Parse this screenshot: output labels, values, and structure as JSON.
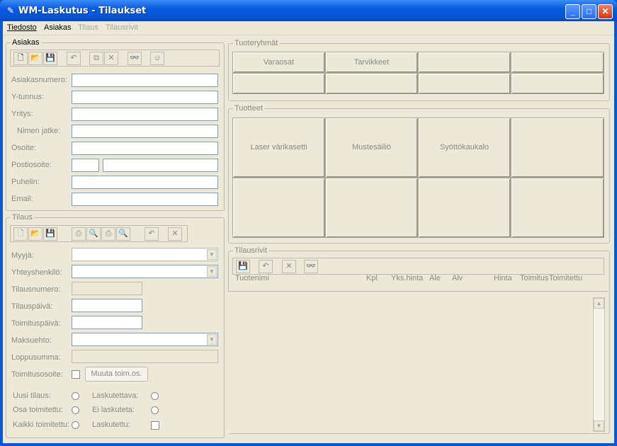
{
  "window": {
    "title": "WM-Laskutus - Tilaukset",
    "icon": "pencil-icon"
  },
  "menu": [
    {
      "label": "Tiedosto",
      "enabled": true
    },
    {
      "label": "Asiakas",
      "enabled": true
    },
    {
      "label": "Tilaus",
      "enabled": false
    },
    {
      "label": "Tilausrivit",
      "enabled": false
    }
  ],
  "asiakas": {
    "legend": "Asiakas",
    "fields": {
      "asiakasnumero": "Asiakasnumero:",
      "ytunnus": "Y-tunnus:",
      "yritys": "Yritys:",
      "nimen_jatke": "Nimen jatke:",
      "osoite": "Osoite:",
      "postiosoite": "Postiosoite:",
      "puhelin": "Puhelin:",
      "email": "Email:"
    }
  },
  "tilaus": {
    "legend": "Tilaus",
    "fields": {
      "myyja": "Myyjä:",
      "yhteyshenkilo": "Yhteyshenkilö:",
      "tilausnumero": "Tilausnumero:",
      "tilauspaiva": "Tilauspäivä:",
      "toimituspaiva": "Toimituspäivä:",
      "maksuehto": "Maksuehto:",
      "loppusumma": "Loppusumma:",
      "toimitusosoite": "Toimitusosoite:"
    },
    "muuta_button": "Muuta toim.os.",
    "status": {
      "uusi": "Uusi tilaus:",
      "osa": "Osa toimitettu:",
      "kaikki": "Kaikki toimitettu:",
      "laskutettava": "Laskutettava:",
      "ei_laskuteta": "Ei laskuteta:",
      "laskutettu": "Laskutettu:"
    }
  },
  "tuoteryhmat": {
    "legend": "Tuoteryhmät",
    "buttons": [
      "Varaosat",
      "Tarvikkeet",
      "",
      "",
      "",
      "",
      "",
      ""
    ]
  },
  "tuotteet": {
    "legend": "Tuotteet",
    "buttons": [
      "Laser värikasetti",
      "Mustesäiliö",
      "Syöttökaukalo",
      "",
      "",
      "",
      "",
      ""
    ]
  },
  "tilausrivit": {
    "legend": "Tilausrivit",
    "columns": [
      "Tuotenimi",
      "Kpl",
      "Yks.hinta",
      "Ale",
      "Alv",
      "Hinta",
      "Toimitus",
      "Toimitettu"
    ]
  }
}
